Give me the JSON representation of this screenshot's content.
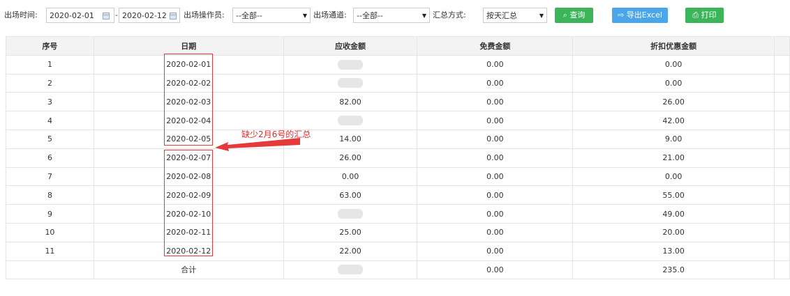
{
  "filters": {
    "time_label": "出场时间:",
    "start_date": "2020-02-01",
    "date_separator": "-",
    "end_date": "2020-02-12",
    "operator_label": "出场操作员:",
    "operator_value": "--全部--",
    "channel_label": "出场通道:",
    "channel_value": "--全部--",
    "summary_label": "汇总方式:",
    "summary_value": "按天汇总"
  },
  "buttons": {
    "query": "查询",
    "export": "导出Excel",
    "print": "打印"
  },
  "table": {
    "columns": [
      "序号",
      "日期",
      "应收金额",
      "免费金额",
      "折扣优惠金额"
    ],
    "rows": [
      {
        "no": "1",
        "date": "2020-02-01",
        "receivable": "",
        "free": "0.00",
        "discount": "0.00"
      },
      {
        "no": "2",
        "date": "2020-02-02",
        "receivable": "",
        "free": "0.00",
        "discount": "0.00"
      },
      {
        "no": "3",
        "date": "2020-02-03",
        "receivable": "82.00",
        "free": "0.00",
        "discount": "26.00"
      },
      {
        "no": "4",
        "date": "2020-02-04",
        "receivable": "",
        "free": "0.00",
        "discount": "42.00"
      },
      {
        "no": "5",
        "date": "2020-02-05",
        "receivable": "14.00",
        "free": "0.00",
        "discount": "9.00"
      },
      {
        "no": "6",
        "date": "2020-02-07",
        "receivable": "26.00",
        "free": "0.00",
        "discount": "21.00"
      },
      {
        "no": "7",
        "date": "2020-02-08",
        "receivable": "0.00",
        "free": "0.00",
        "discount": "0.00"
      },
      {
        "no": "8",
        "date": "2020-02-09",
        "receivable": "63.00",
        "free": "0.00",
        "discount": "55.00"
      },
      {
        "no": "9",
        "date": "2020-02-10",
        "receivable": "",
        "free": "0.00",
        "discount": "49.00"
      },
      {
        "no": "10",
        "date": "2020-02-11",
        "receivable": "25.00",
        "free": "0.00",
        "discount": "20.00"
      },
      {
        "no": "11",
        "date": "2020-02-12",
        "receivable": "22.00",
        "free": "0.00",
        "discount": "13.00"
      }
    ],
    "total": {
      "no": "",
      "date": "合计",
      "receivable": "",
      "free": "0.00",
      "discount": "235.0"
    }
  },
  "annotation": {
    "text": "缺少2月6号的汇总",
    "color": "#e02b2b"
  },
  "colors": {
    "green_button": "#3cb55a",
    "blue_button": "#4aa6e8",
    "header_bg": "#f3f3f3",
    "highlight_box": "#e63a3a"
  },
  "icons": {
    "calendar": "calendar-icon",
    "dropdown": "caret-down-icon",
    "search": "search-icon",
    "export": "export-icon",
    "print": "printer-icon",
    "arrow": "arrow-left-icon"
  }
}
